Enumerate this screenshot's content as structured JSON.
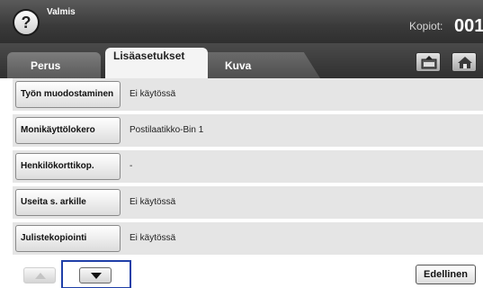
{
  "header": {
    "help_glyph": "?",
    "status": "Valmis",
    "copies_label": "Kopiot:",
    "copies_value": "001"
  },
  "tabs": [
    {
      "label": "Perus",
      "active": false
    },
    {
      "label": "Lisäasetukset",
      "active": true
    },
    {
      "label": "Kuva",
      "active": false
    }
  ],
  "toolbar_icons": [
    "job-build-icon",
    "home-icon"
  ],
  "rows": [
    {
      "label": "Työn muodostaminen",
      "value": "Ei käytössä"
    },
    {
      "label": "Monikäyttölokero",
      "value": "Postilaatikko-Bin 1"
    },
    {
      "label": "Henkilökorttikop.",
      "value": "-"
    },
    {
      "label": "Useita s. arkille",
      "value": "Ei käytössä"
    },
    {
      "label": "Julistekopiointi",
      "value": "Ei käytössä"
    }
  ],
  "footer": {
    "previous_label": "Edellinen",
    "up_enabled": false,
    "down_enabled": true
  },
  "colors": {
    "header_dark": "#3a3a3a",
    "row_bg": "#e5e5e5",
    "focus": "#1f3fa8"
  }
}
